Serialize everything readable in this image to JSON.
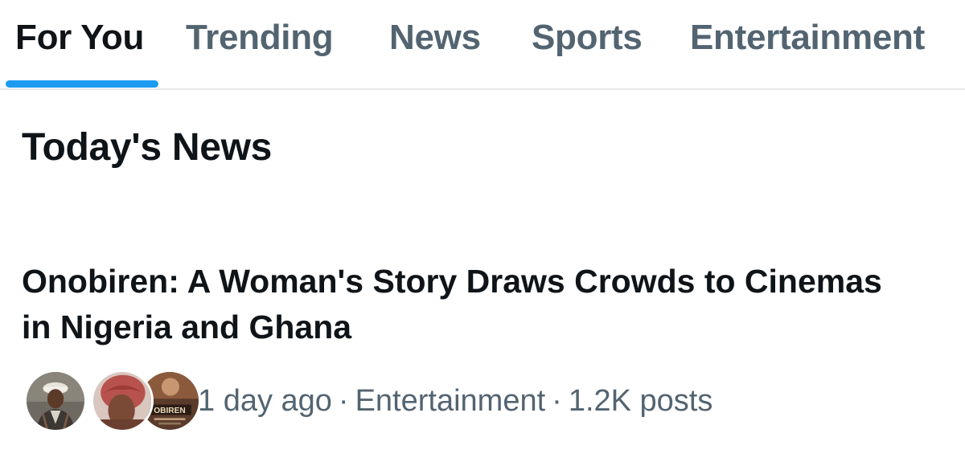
{
  "tabs": [
    {
      "label": "For You",
      "active": true
    },
    {
      "label": "Trending",
      "active": false
    },
    {
      "label": "News",
      "active": false
    },
    {
      "label": "Sports",
      "active": false
    },
    {
      "label": "Entertainment",
      "active": false
    }
  ],
  "section": {
    "title": "Today's News"
  },
  "story": {
    "headline": "Onobiren: A Woman's Story Draws Crowds to Cinemas in Nigeria and Ghana",
    "time": "1 day ago",
    "separator": "·",
    "category": "Entertainment",
    "posts": "1.2K posts",
    "poster_text": "OBIREN",
    "avatar_icons": [
      "person-portrait-icon",
      "woman-red-headwrap-icon",
      "movie-poster-icon"
    ]
  },
  "colors": {
    "text_primary": "#0f1419",
    "text_secondary": "#536471",
    "accent": "#1d9bf0",
    "divider": "#e6e8ea"
  }
}
